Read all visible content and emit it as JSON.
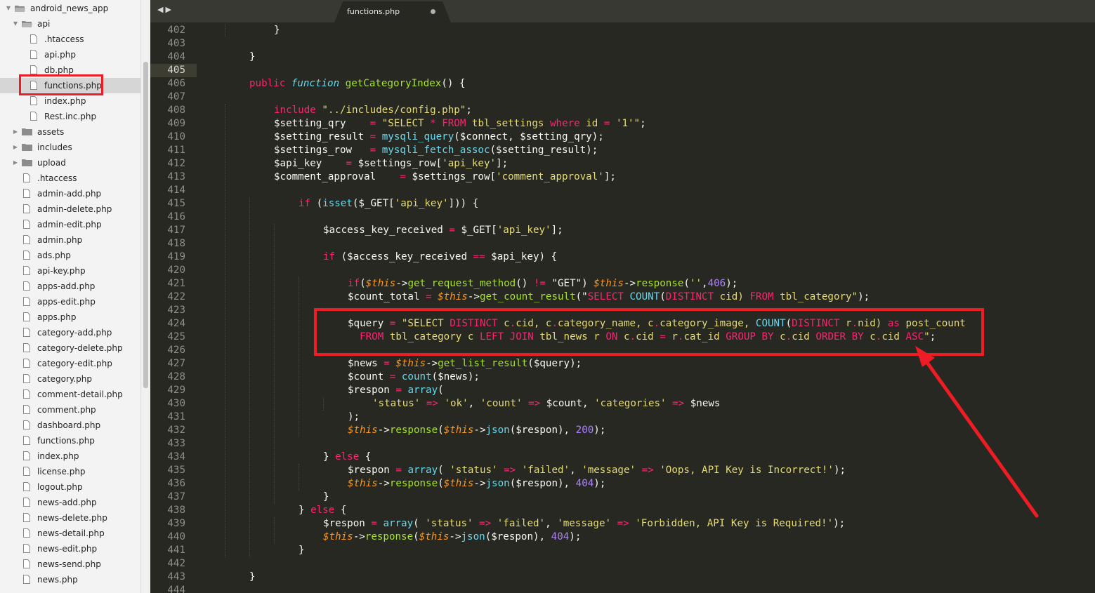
{
  "sidebar": {
    "root": "android_news_app",
    "api_folder": "api",
    "api_files": [
      ".htaccess",
      "api.php",
      "db.php",
      "functions.php",
      "index.php",
      "Rest.inc.php"
    ],
    "folders": [
      "assets",
      "includes",
      "upload"
    ],
    "root_files": [
      ".htaccess",
      "admin-add.php",
      "admin-delete.php",
      "admin-edit.php",
      "admin.php",
      "ads.php",
      "api-key.php",
      "apps-add.php",
      "apps-edit.php",
      "apps.php",
      "category-add.php",
      "category-delete.php",
      "category-edit.php",
      "category.php",
      "comment-detail.php",
      "comment.php",
      "dashboard.php",
      "functions.php",
      "index.php",
      "license.php",
      "logout.php",
      "news-add.php",
      "news-delete.php",
      "news-detail.php",
      "news-edit.php",
      "news-send.php",
      "news.php"
    ],
    "selected": "functions.php"
  },
  "tab": {
    "label": "functions.php"
  },
  "editor": {
    "current_line": 405,
    "lines": [
      {
        "n": 402,
        "indent": 2,
        "t": [
          [
            "}",
            ""
          ]
        ]
      },
      {
        "n": 403,
        "indent": 0,
        "t": []
      },
      {
        "n": 404,
        "indent": 1,
        "t": [
          [
            "}",
            ""
          ]
        ]
      },
      {
        "n": 405,
        "indent": 0,
        "t": []
      },
      {
        "n": 406,
        "indent": 1,
        "t": [
          [
            "public ",
            "kw"
          ],
          [
            "function ",
            "st-it"
          ],
          [
            "getCategoryIndex",
            "fn"
          ],
          [
            "() {",
            ""
          ]
        ]
      },
      {
        "n": 407,
        "indent": 0,
        "t": []
      },
      {
        "n": 408,
        "indent": 2,
        "t": [
          [
            "include ",
            "kw"
          ],
          [
            "\"../includes/config.php\"",
            "st"
          ],
          [
            ";",
            ""
          ]
        ]
      },
      {
        "n": 409,
        "indent": 2,
        "t": [
          [
            "$setting_qry    ",
            ""
          ],
          [
            "= ",
            "kw"
          ],
          [
            "\"SELECT ",
            "st"
          ],
          [
            "* ",
            "kw"
          ],
          [
            "FROM ",
            "kw"
          ],
          [
            "tbl_settings ",
            "st"
          ],
          [
            "where ",
            "kw"
          ],
          [
            "id ",
            "st"
          ],
          [
            "= ",
            "kw"
          ],
          [
            "'1'\"",
            "st"
          ],
          [
            ";",
            ""
          ]
        ]
      },
      {
        "n": 410,
        "indent": 2,
        "t": [
          [
            "$setting_result ",
            ""
          ],
          [
            "= ",
            "kw"
          ],
          [
            "mysqli_query",
            "bi"
          ],
          [
            "($connect, $setting_qry);",
            ""
          ]
        ]
      },
      {
        "n": 411,
        "indent": 2,
        "t": [
          [
            "$settings_row   ",
            ""
          ],
          [
            "= ",
            "kw"
          ],
          [
            "mysqli_fetch_assoc",
            "bi"
          ],
          [
            "($setting_result);",
            ""
          ]
        ]
      },
      {
        "n": 412,
        "indent": 2,
        "t": [
          [
            "$api_key    ",
            ""
          ],
          [
            "= ",
            "kw"
          ],
          [
            "$settings_row[",
            ""
          ],
          [
            "'api_key'",
            "st"
          ],
          [
            "];",
            ""
          ]
        ]
      },
      {
        "n": 413,
        "indent": 2,
        "t": [
          [
            "$comment_approval    ",
            ""
          ],
          [
            "= ",
            "kw"
          ],
          [
            "$settings_row[",
            ""
          ],
          [
            "'comment_approval'",
            "st"
          ],
          [
            "];",
            ""
          ]
        ]
      },
      {
        "n": 414,
        "indent": 0,
        "t": []
      },
      {
        "n": 415,
        "indent": 3,
        "t": [
          [
            "if ",
            "kw"
          ],
          [
            "(",
            ""
          ],
          [
            "isset",
            "bi"
          ],
          [
            "($_GET[",
            ""
          ],
          [
            "'api_key'",
            "st"
          ],
          [
            "])) {",
            ""
          ]
        ]
      },
      {
        "n": 416,
        "indent": 0,
        "t": []
      },
      {
        "n": 417,
        "indent": 4,
        "t": [
          [
            "$access_key_received ",
            ""
          ],
          [
            "= ",
            "kw"
          ],
          [
            "$_GET[",
            ""
          ],
          [
            "'api_key'",
            "st"
          ],
          [
            "];",
            ""
          ]
        ]
      },
      {
        "n": 418,
        "indent": 0,
        "t": []
      },
      {
        "n": 419,
        "indent": 4,
        "t": [
          [
            "if ",
            "kw"
          ],
          [
            "($access_key_received ",
            ""
          ],
          [
            "== ",
            "kw"
          ],
          [
            "$api_key) {",
            ""
          ]
        ]
      },
      {
        "n": 420,
        "indent": 0,
        "t": []
      },
      {
        "n": 421,
        "indent": 5,
        "t": [
          [
            "if",
            "kw"
          ],
          [
            "(",
            ""
          ],
          [
            "$this",
            "sf"
          ],
          [
            "->",
            ""
          ],
          [
            "get_request_method",
            "fn"
          ],
          [
            "() ",
            ""
          ],
          [
            "!= ",
            "kw"
          ],
          [
            "\"GET\") ",
            ""
          ],
          [
            "$this",
            "sf"
          ],
          [
            "->",
            ""
          ],
          [
            "response",
            "fn"
          ],
          [
            "(",
            ""
          ],
          [
            "''",
            "st"
          ],
          [
            ",",
            ""
          ],
          [
            "406",
            "nu"
          ],
          [
            ");",
            ""
          ]
        ]
      },
      {
        "n": 422,
        "indent": 5,
        "t": [
          [
            "$count_total ",
            ""
          ],
          [
            "= ",
            "kw"
          ],
          [
            "$this",
            "sf"
          ],
          [
            "->",
            ""
          ],
          [
            "get_count_result",
            "fn"
          ],
          [
            "(\"",
            ""
          ],
          [
            "SELECT ",
            "kw"
          ],
          [
            "COUNT",
            "bi"
          ],
          [
            "(",
            ""
          ],
          [
            "DISTINCT ",
            "kw"
          ],
          [
            "cid) ",
            "st"
          ],
          [
            "FROM ",
            "kw"
          ],
          [
            "tbl_category\"",
            "st"
          ],
          [
            ");",
            ""
          ]
        ]
      },
      {
        "n": 423,
        "indent": 0,
        "t": []
      },
      {
        "n": 424,
        "indent": 5,
        "t": [
          [
            "$query ",
            ""
          ],
          [
            "= ",
            "kw"
          ],
          [
            "\"SELECT ",
            "st"
          ],
          [
            "DISTINCT ",
            "kw"
          ],
          [
            "c",
            "st"
          ],
          [
            ".",
            "kw"
          ],
          [
            "cid, ",
            "st"
          ],
          [
            "c",
            "st"
          ],
          [
            ".",
            "kw"
          ],
          [
            "category_name, ",
            "st"
          ],
          [
            "c",
            "st"
          ],
          [
            ".",
            "kw"
          ],
          [
            "category_image, ",
            "st"
          ],
          [
            "COUNT",
            "bi"
          ],
          [
            "(",
            ""
          ],
          [
            "DISTINCT ",
            "kw"
          ],
          [
            "r",
            "st"
          ],
          [
            ".",
            "kw"
          ],
          [
            "nid) ",
            "st"
          ],
          [
            "as ",
            "kw"
          ],
          [
            "post_count",
            "st"
          ]
        ]
      },
      {
        "n": 425,
        "indent": 5,
        "t": [
          [
            "  ",
            ""
          ],
          [
            "FROM ",
            "kw"
          ],
          [
            "tbl_category ",
            "st"
          ],
          [
            "c ",
            "st"
          ],
          [
            "LEFT ",
            "kw"
          ],
          [
            "JOIN ",
            "kw"
          ],
          [
            "tbl_news ",
            "st"
          ],
          [
            "r ",
            "st"
          ],
          [
            "ON ",
            "kw"
          ],
          [
            "c",
            "st"
          ],
          [
            ".",
            "kw"
          ],
          [
            "cid ",
            "st"
          ],
          [
            "= ",
            "kw"
          ],
          [
            "r",
            "st"
          ],
          [
            ".",
            "kw"
          ],
          [
            "cat_id ",
            "st"
          ],
          [
            "GROUP ",
            "kw"
          ],
          [
            "BY ",
            "kw"
          ],
          [
            "c",
            "st"
          ],
          [
            ".",
            "kw"
          ],
          [
            "cid ",
            "st"
          ],
          [
            "ORDER ",
            "kw"
          ],
          [
            "BY ",
            "kw"
          ],
          [
            "c",
            "st"
          ],
          [
            ".",
            "kw"
          ],
          [
            "cid ",
            "st"
          ],
          [
            "ASC",
            "kw"
          ],
          [
            "\"",
            "st"
          ],
          [
            ";",
            ""
          ]
        ]
      },
      {
        "n": 426,
        "indent": 0,
        "t": []
      },
      {
        "n": 427,
        "indent": 5,
        "t": [
          [
            "$news ",
            ""
          ],
          [
            "= ",
            "kw"
          ],
          [
            "$this",
            "sf"
          ],
          [
            "->",
            ""
          ],
          [
            "get_list_result",
            "fn"
          ],
          [
            "($query);",
            ""
          ]
        ]
      },
      {
        "n": 428,
        "indent": 5,
        "t": [
          [
            "$count ",
            ""
          ],
          [
            "= ",
            "kw"
          ],
          [
            "count",
            "bi"
          ],
          [
            "($news);",
            ""
          ]
        ]
      },
      {
        "n": 429,
        "indent": 5,
        "t": [
          [
            "$respon ",
            ""
          ],
          [
            "= ",
            "kw"
          ],
          [
            "array",
            "bi"
          ],
          [
            "(",
            ""
          ]
        ]
      },
      {
        "n": 430,
        "indent": 6,
        "t": [
          [
            "'status' ",
            "st"
          ],
          [
            "=> ",
            "kw"
          ],
          [
            "'ok'",
            "st"
          ],
          [
            ", ",
            ""
          ],
          [
            "'count' ",
            "st"
          ],
          [
            "=> ",
            "kw"
          ],
          [
            "$count, ",
            ""
          ],
          [
            "'categories' ",
            "st"
          ],
          [
            "=> ",
            "kw"
          ],
          [
            "$news",
            ""
          ]
        ]
      },
      {
        "n": 431,
        "indent": 5,
        "t": [
          [
            ");",
            ""
          ]
        ]
      },
      {
        "n": 432,
        "indent": 5,
        "t": [
          [
            "$this",
            "sf"
          ],
          [
            "->",
            ""
          ],
          [
            "response",
            "fn"
          ],
          [
            "(",
            ""
          ],
          [
            "$this",
            "sf"
          ],
          [
            "->",
            ""
          ],
          [
            "json",
            "bi"
          ],
          [
            "($respon), ",
            ""
          ],
          [
            "200",
            "nu"
          ],
          [
            ");",
            ""
          ]
        ]
      },
      {
        "n": 433,
        "indent": 0,
        "t": []
      },
      {
        "n": 434,
        "indent": 4,
        "t": [
          [
            "} ",
            ""
          ],
          [
            "else ",
            "kw"
          ],
          [
            "{",
            ""
          ]
        ]
      },
      {
        "n": 435,
        "indent": 5,
        "t": [
          [
            "$respon ",
            ""
          ],
          [
            "= ",
            "kw"
          ],
          [
            "array",
            "bi"
          ],
          [
            "( ",
            ""
          ],
          [
            "'status' ",
            "st"
          ],
          [
            "=> ",
            "kw"
          ],
          [
            "'failed'",
            "st"
          ],
          [
            ", ",
            ""
          ],
          [
            "'message' ",
            "st"
          ],
          [
            "=> ",
            "kw"
          ],
          [
            "'Oops, API Key is Incorrect!'",
            "st"
          ],
          [
            ");",
            ""
          ]
        ]
      },
      {
        "n": 436,
        "indent": 5,
        "t": [
          [
            "$this",
            "sf"
          ],
          [
            "->",
            ""
          ],
          [
            "response",
            "fn"
          ],
          [
            "(",
            ""
          ],
          [
            "$this",
            "sf"
          ],
          [
            "->",
            ""
          ],
          [
            "json",
            "bi"
          ],
          [
            "($respon), ",
            ""
          ],
          [
            "404",
            "nu"
          ],
          [
            ");",
            ""
          ]
        ]
      },
      {
        "n": 437,
        "indent": 4,
        "t": [
          [
            "}",
            ""
          ]
        ]
      },
      {
        "n": 438,
        "indent": 3,
        "t": [
          [
            "} ",
            ""
          ],
          [
            "else ",
            "kw"
          ],
          [
            "{",
            ""
          ]
        ]
      },
      {
        "n": 439,
        "indent": 4,
        "t": [
          [
            "$respon ",
            ""
          ],
          [
            "= ",
            "kw"
          ],
          [
            "array",
            "bi"
          ],
          [
            "( ",
            ""
          ],
          [
            "'status' ",
            "st"
          ],
          [
            "=> ",
            "kw"
          ],
          [
            "'failed'",
            "st"
          ],
          [
            ", ",
            ""
          ],
          [
            "'message' ",
            "st"
          ],
          [
            "=> ",
            "kw"
          ],
          [
            "'Forbidden, API Key is Required!'",
            "st"
          ],
          [
            ");",
            ""
          ]
        ]
      },
      {
        "n": 440,
        "indent": 4,
        "t": [
          [
            "$this",
            "sf"
          ],
          [
            "->",
            ""
          ],
          [
            "response",
            "fn"
          ],
          [
            "(",
            ""
          ],
          [
            "$this",
            "sf"
          ],
          [
            "->",
            ""
          ],
          [
            "json",
            "bi"
          ],
          [
            "($respon), ",
            ""
          ],
          [
            "404",
            "nu"
          ],
          [
            ");",
            ""
          ]
        ]
      },
      {
        "n": 441,
        "indent": 3,
        "t": [
          [
            "}",
            ""
          ]
        ]
      },
      {
        "n": 442,
        "indent": 0,
        "t": []
      },
      {
        "n": 443,
        "indent": 1,
        "t": [
          [
            "}",
            ""
          ]
        ]
      },
      {
        "n": 444,
        "indent": 0,
        "t": []
      }
    ]
  },
  "colors": {
    "editor_bg": "#272822",
    "keyword": "#f92672",
    "string": "#e6db74",
    "function": "#a6e22e",
    "builtin": "#66d9ef",
    "this": "#fd971f",
    "number": "#ae81ff",
    "annotation_red": "#ee1c24"
  }
}
